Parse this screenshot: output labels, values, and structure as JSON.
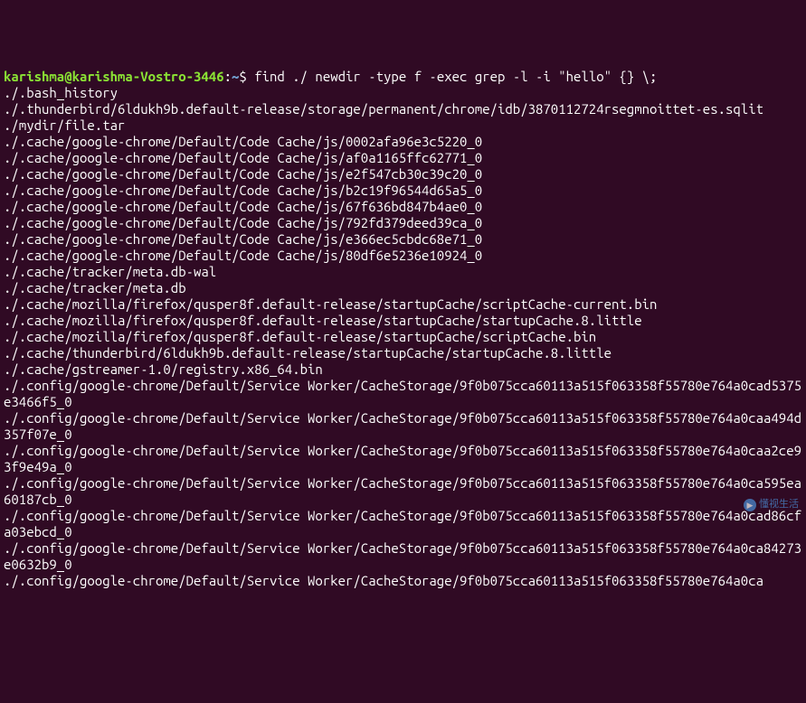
{
  "prompt": {
    "user_host": "karishma@karishma-Vostro-3446",
    "separator": ":",
    "path": "~",
    "symbol": "$ "
  },
  "command": "find ./ newdir -type f -exec grep -l -i \"hello\" {} \\;",
  "output_lines": [
    "./.bash_history",
    "./.thunderbird/6ldukh9b.default-release/storage/permanent/chrome/idb/3870112724rsegmnoittet-es.sqlit",
    "./mydir/file.tar",
    "./.cache/google-chrome/Default/Code Cache/js/0002afa96e3c5220_0",
    "./.cache/google-chrome/Default/Code Cache/js/af0a1165ffc62771_0",
    "./.cache/google-chrome/Default/Code Cache/js/e2f547cb30c39c20_0",
    "./.cache/google-chrome/Default/Code Cache/js/b2c19f96544d65a5_0",
    "./.cache/google-chrome/Default/Code Cache/js/67f636bd847b4ae0_0",
    "./.cache/google-chrome/Default/Code Cache/js/792fd379deed39ca_0",
    "./.cache/google-chrome/Default/Code Cache/js/e366ec5cbdc68e71_0",
    "./.cache/google-chrome/Default/Code Cache/js/80df6e5236e10924_0",
    "./.cache/tracker/meta.db-wal",
    "./.cache/tracker/meta.db",
    "./.cache/mozilla/firefox/qusper8f.default-release/startupCache/scriptCache-current.bin",
    "./.cache/mozilla/firefox/qusper8f.default-release/startupCache/startupCache.8.little",
    "./.cache/mozilla/firefox/qusper8f.default-release/startupCache/scriptCache.bin",
    "./.cache/thunderbird/6ldukh9b.default-release/startupCache/startupCache.8.little",
    "./.cache/gstreamer-1.0/registry.x86_64.bin",
    "./.config/google-chrome/Default/Service Worker/CacheStorage/9f0b075cca60113a515f063358f55780e764a0cad5375e3466f5_0",
    "./.config/google-chrome/Default/Service Worker/CacheStorage/9f0b075cca60113a515f063358f55780e764a0caa494d357f07e_0",
    "./.config/google-chrome/Default/Service Worker/CacheStorage/9f0b075cca60113a515f063358f55780e764a0caa2ce93f9e49a_0",
    "./.config/google-chrome/Default/Service Worker/CacheStorage/9f0b075cca60113a515f063358f55780e764a0ca595ea60187cb_0",
    "./.config/google-chrome/Default/Service Worker/CacheStorage/9f0b075cca60113a515f063358f55780e764a0cad86cfa03ebcd_0",
    "./.config/google-chrome/Default/Service Worker/CacheStorage/9f0b075cca60113a515f063358f55780e764a0ca84273e0632b9_0",
    "./.config/google-chrome/Default/Service Worker/CacheStorage/9f0b075cca60113a515f063358f55780e764a0ca"
  ],
  "watermark": {
    "text": "懂视生活"
  }
}
